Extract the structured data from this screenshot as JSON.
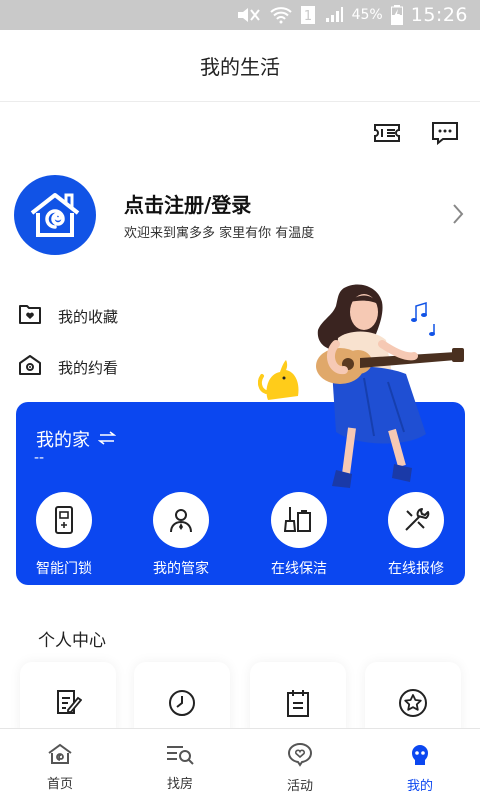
{
  "status_bar": {
    "battery": "45%",
    "time": "15:26",
    "sim": "1"
  },
  "header": {
    "title": "我的生活"
  },
  "profile": {
    "login_label": "点击注册/登录",
    "welcome": "欢迎来到寓多多 家里有你 有温度"
  },
  "links": [
    {
      "label": "我的收藏"
    },
    {
      "label": "我的约看"
    }
  ],
  "home_card": {
    "title": "我的家",
    "subtitle": "--",
    "services": [
      {
        "label": "智能门锁",
        "icon": "smart-lock-icon"
      },
      {
        "label": "我的管家",
        "icon": "butler-icon"
      },
      {
        "label": "在线保洁",
        "icon": "cleaning-icon"
      },
      {
        "label": "在线报修",
        "icon": "repair-icon"
      }
    ]
  },
  "personal_center": {
    "title": "个人中心",
    "icons": [
      "edit-document-icon",
      "clock-icon",
      "clipboard-icon",
      "star-icon"
    ]
  },
  "tabbar": {
    "tabs": [
      {
        "label": "首页",
        "icon": "home-icon"
      },
      {
        "label": "找房",
        "icon": "find-house-icon"
      },
      {
        "label": "活动",
        "icon": "activity-icon"
      },
      {
        "label": "我的",
        "icon": "me-icon",
        "active": true
      }
    ]
  },
  "colors": {
    "accent": "#0b47f0",
    "avatar_bg": "#1153e6",
    "status_bar": "#c9c9c9"
  }
}
